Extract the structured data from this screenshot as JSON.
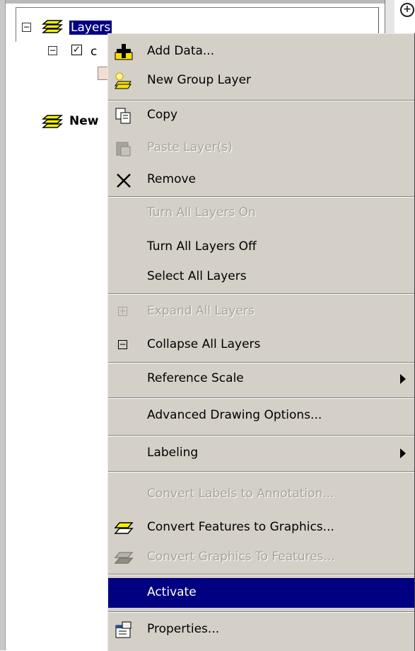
{
  "toc": {
    "root_label": "Layers",
    "child_label_partial": "c",
    "new_group_label": "New",
    "expander_symbol": "⊟",
    "checkbox_symbol": "☑"
  },
  "top_right_icon": "add-data-circle-icon",
  "menu": {
    "items": [
      {
        "label": "Add Data...",
        "icon": "add-data-icon",
        "state": "enabled"
      },
      {
        "label": "New Group Layer",
        "icon": "new-group-layer-icon",
        "state": "enabled"
      },
      {
        "label": "Copy",
        "icon": "copy-icon",
        "state": "enabled"
      },
      {
        "label": "Paste Layer(s)",
        "icon": "paste-icon",
        "state": "disabled"
      },
      {
        "label": "Remove",
        "icon": "remove-icon",
        "state": "enabled"
      },
      {
        "label": "Turn All Layers On",
        "state": "disabled"
      },
      {
        "label": "Turn All Layers Off",
        "state": "enabled"
      },
      {
        "label": "Select All Layers",
        "state": "enabled"
      },
      {
        "label": "Expand All Layers",
        "icon": "expand-icon",
        "state": "disabled"
      },
      {
        "label": "Collapse All Layers",
        "icon": "collapse-icon",
        "state": "enabled"
      },
      {
        "label": "Reference Scale",
        "state": "enabled",
        "submenu": true
      },
      {
        "label": "Advanced Drawing Options...",
        "state": "enabled"
      },
      {
        "label": "Labeling",
        "state": "enabled",
        "submenu": true
      },
      {
        "label": "Convert Labels to Annotation...",
        "state": "disabled"
      },
      {
        "label": "Convert Features to Graphics...",
        "icon": "convert-features-icon",
        "state": "enabled"
      },
      {
        "label": "Convert Graphics To Features...",
        "icon": "convert-graphics-icon",
        "state": "disabled"
      },
      {
        "label": "Activate",
        "state": "highlighted"
      },
      {
        "label": "Properties...",
        "icon": "properties-icon",
        "state": "enabled"
      }
    ]
  },
  "colors": {
    "selection": "#000080",
    "menu_bg": "#d4d0c8",
    "disabled_text": "#a7a49c"
  }
}
